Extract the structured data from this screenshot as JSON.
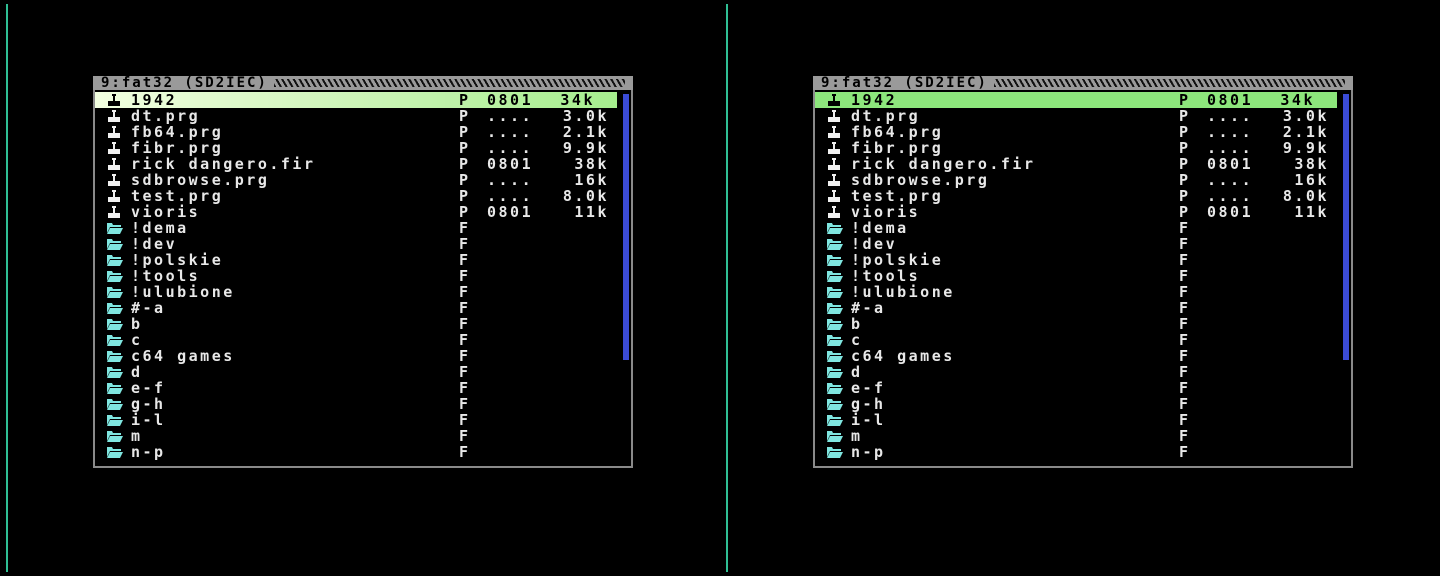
{
  "panels": [
    {
      "title": "9:fat32 (SD2IEC)",
      "rows": [
        {
          "icon": "joystick-icon",
          "name": "1942",
          "type": "P",
          "addr": "0801",
          "size": "34k",
          "selected": true
        },
        {
          "icon": "joystick-icon",
          "name": "dt.prg",
          "type": "P",
          "addr": "....",
          "size": "3.0k"
        },
        {
          "icon": "joystick-icon",
          "name": "fb64.prg",
          "type": "P",
          "addr": "....",
          "size": "2.1k"
        },
        {
          "icon": "joystick-icon",
          "name": "fibr.prg",
          "type": "P",
          "addr": "....",
          "size": "9.9k"
        },
        {
          "icon": "joystick-icon",
          "name": "rick dangero.fir",
          "type": "P",
          "addr": "0801",
          "size": "38k"
        },
        {
          "icon": "joystick-icon",
          "name": "sdbrowse.prg",
          "type": "P",
          "addr": "....",
          "size": "16k"
        },
        {
          "icon": "joystick-icon",
          "name": "test.prg",
          "type": "P",
          "addr": "....",
          "size": "8.0k"
        },
        {
          "icon": "joystick-icon",
          "name": "vioris",
          "type": "P",
          "addr": "0801",
          "size": "11k"
        },
        {
          "icon": "folder-icon",
          "name": "!dema",
          "type": "F",
          "addr": "",
          "size": ""
        },
        {
          "icon": "folder-icon",
          "name": "!dev",
          "type": "F",
          "addr": "",
          "size": ""
        },
        {
          "icon": "folder-icon",
          "name": "!polskie",
          "type": "F",
          "addr": "",
          "size": ""
        },
        {
          "icon": "folder-icon",
          "name": "!tools",
          "type": "F",
          "addr": "",
          "size": ""
        },
        {
          "icon": "folder-icon",
          "name": "!ulubione",
          "type": "F",
          "addr": "",
          "size": ""
        },
        {
          "icon": "folder-icon",
          "name": "#-a",
          "type": "F",
          "addr": "",
          "size": ""
        },
        {
          "icon": "folder-icon",
          "name": "b",
          "type": "F",
          "addr": "",
          "size": ""
        },
        {
          "icon": "folder-icon",
          "name": "c",
          "type": "F",
          "addr": "",
          "size": ""
        },
        {
          "icon": "folder-icon",
          "name": "c64 games",
          "type": "F",
          "addr": "",
          "size": ""
        },
        {
          "icon": "folder-icon",
          "name": "d",
          "type": "F",
          "addr": "",
          "size": ""
        },
        {
          "icon": "folder-icon",
          "name": "e-f",
          "type": "F",
          "addr": "",
          "size": ""
        },
        {
          "icon": "folder-icon",
          "name": "g-h",
          "type": "F",
          "addr": "",
          "size": ""
        },
        {
          "icon": "folder-icon",
          "name": "i-l",
          "type": "F",
          "addr": "",
          "size": ""
        },
        {
          "icon": "folder-icon",
          "name": "m",
          "type": "F",
          "addr": "",
          "size": ""
        },
        {
          "icon": "folder-icon",
          "name": "n-p",
          "type": "F",
          "addr": "",
          "size": ""
        }
      ]
    },
    {
      "title": "9:fat32 (SD2IEC)",
      "rows": [
        {
          "icon": "joystick-icon",
          "name": "1942",
          "type": "P",
          "addr": "0801",
          "size": "34k",
          "selected": true
        },
        {
          "icon": "joystick-icon",
          "name": "dt.prg",
          "type": "P",
          "addr": "....",
          "size": "3.0k"
        },
        {
          "icon": "joystick-icon",
          "name": "fb64.prg",
          "type": "P",
          "addr": "....",
          "size": "2.1k"
        },
        {
          "icon": "joystick-icon",
          "name": "fibr.prg",
          "type": "P",
          "addr": "....",
          "size": "9.9k"
        },
        {
          "icon": "joystick-icon",
          "name": "rick dangero.fir",
          "type": "P",
          "addr": "0801",
          "size": "38k"
        },
        {
          "icon": "joystick-icon",
          "name": "sdbrowse.prg",
          "type": "P",
          "addr": "....",
          "size": "16k"
        },
        {
          "icon": "joystick-icon",
          "name": "test.prg",
          "type": "P",
          "addr": "....",
          "size": "8.0k"
        },
        {
          "icon": "joystick-icon",
          "name": "vioris",
          "type": "P",
          "addr": "0801",
          "size": "11k"
        },
        {
          "icon": "folder-icon",
          "name": "!dema",
          "type": "F",
          "addr": "",
          "size": ""
        },
        {
          "icon": "folder-icon",
          "name": "!dev",
          "type": "F",
          "addr": "",
          "size": ""
        },
        {
          "icon": "folder-icon",
          "name": "!polskie",
          "type": "F",
          "addr": "",
          "size": ""
        },
        {
          "icon": "folder-icon",
          "name": "!tools",
          "type": "F",
          "addr": "",
          "size": ""
        },
        {
          "icon": "folder-icon",
          "name": "!ulubione",
          "type": "F",
          "addr": "",
          "size": ""
        },
        {
          "icon": "folder-icon",
          "name": "#-a",
          "type": "F",
          "addr": "",
          "size": ""
        },
        {
          "icon": "folder-icon",
          "name": "b",
          "type": "F",
          "addr": "",
          "size": ""
        },
        {
          "icon": "folder-icon",
          "name": "c",
          "type": "F",
          "addr": "",
          "size": ""
        },
        {
          "icon": "folder-icon",
          "name": "c64 games",
          "type": "F",
          "addr": "",
          "size": ""
        },
        {
          "icon": "folder-icon",
          "name": "d",
          "type": "F",
          "addr": "",
          "size": ""
        },
        {
          "icon": "folder-icon",
          "name": "e-f",
          "type": "F",
          "addr": "",
          "size": ""
        },
        {
          "icon": "folder-icon",
          "name": "g-h",
          "type": "F",
          "addr": "",
          "size": ""
        },
        {
          "icon": "folder-icon",
          "name": "i-l",
          "type": "F",
          "addr": "",
          "size": ""
        },
        {
          "icon": "folder-icon",
          "name": "m",
          "type": "F",
          "addr": "",
          "size": ""
        },
        {
          "icon": "folder-icon",
          "name": "n-p",
          "type": "F",
          "addr": "",
          "size": ""
        }
      ]
    }
  ],
  "colors": {
    "divider": "#2fbf94",
    "text": "#e8e8e8",
    "icon_joystick": "#f0f0f0",
    "icon_folder": "#7fe6e0",
    "scrollbar": "#3b4bd6",
    "frame": "#8a8a8a"
  }
}
